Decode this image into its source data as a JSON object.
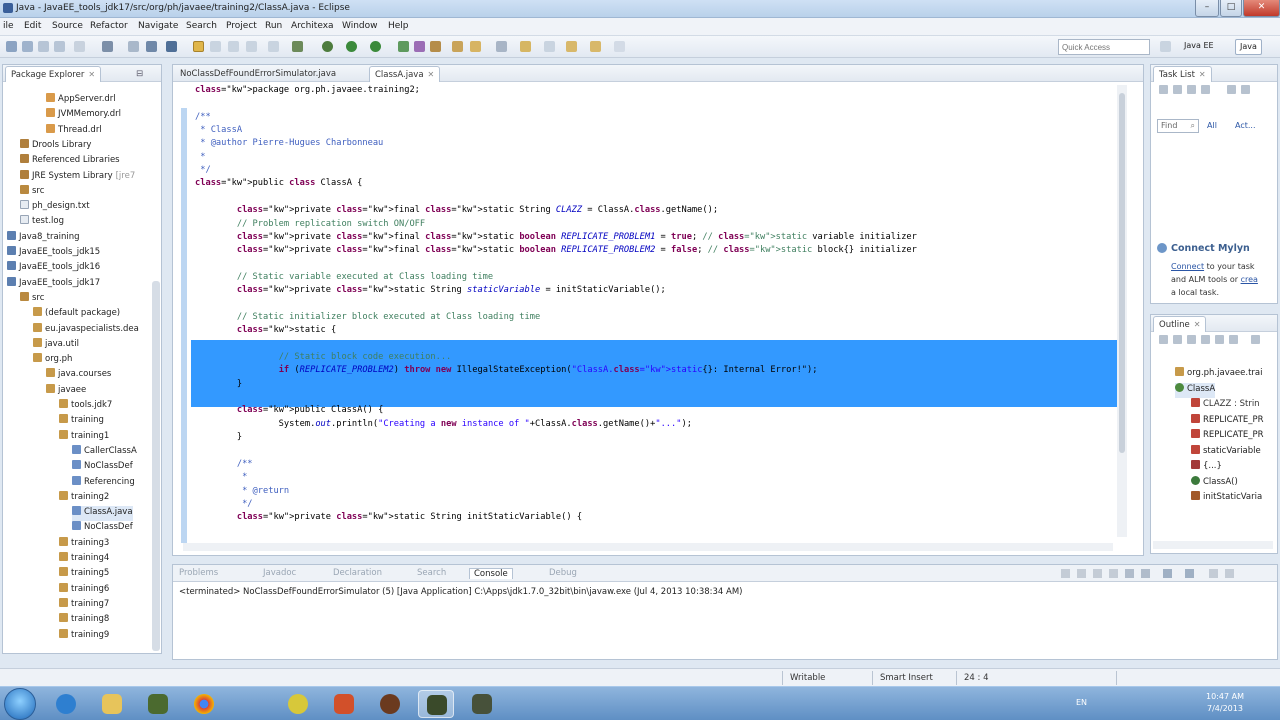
{
  "window": {
    "title": "Java - JavaEE_tools_jdk17/src/org/ph/javaee/training2/ClassA.java - Eclipse"
  },
  "menu": [
    "ile",
    "Edit",
    "Source",
    "Refactor",
    "Navigate",
    "Search",
    "Project",
    "Run",
    "Architexa",
    "Window",
    "Help"
  ],
  "toolbar": {
    "quick_access_placeholder": "Quick Access",
    "perspectives": [
      "Java EE",
      "Java"
    ]
  },
  "package_explorer": {
    "title": "Package Explorer",
    "items": [
      {
        "label": "AppServer.drl",
        "icon": "drl-file-icon",
        "indent": 4
      },
      {
        "label": "JVMMemory.drl",
        "icon": "drl-file-icon",
        "indent": 4
      },
      {
        "label": "Thread.drl",
        "icon": "drl-file-icon",
        "indent": 4
      },
      {
        "label": "Drools Library",
        "icon": "library-icon",
        "indent": 2
      },
      {
        "label": "Referenced Libraries",
        "icon": "library-icon",
        "indent": 2
      },
      {
        "label": "JRE System Library",
        "suffix": "[jre7",
        "icon": "library-icon",
        "indent": 2
      },
      {
        "label": "src",
        "icon": "source-folder-icon",
        "indent": 2
      },
      {
        "label": "ph_design.txt",
        "icon": "text-file-icon",
        "indent": 2
      },
      {
        "label": "test.log",
        "icon": "text-file-icon",
        "indent": 2
      },
      {
        "label": "Java8_training",
        "icon": "project-icon",
        "indent": 1
      },
      {
        "label": "JavaEE_tools_jdk15",
        "icon": "project-icon",
        "indent": 1
      },
      {
        "label": "JavaEE_tools_jdk16",
        "icon": "project-icon",
        "indent": 1
      },
      {
        "label": "JavaEE_tools_jdk17",
        "icon": "project-icon",
        "indent": 1
      },
      {
        "label": "src",
        "icon": "source-folder-icon",
        "indent": 2
      },
      {
        "label": "(default package)",
        "icon": "package-icon",
        "indent": 3
      },
      {
        "label": "eu.javaspecialists.dea",
        "icon": "package-icon",
        "indent": 3
      },
      {
        "label": "java.util",
        "icon": "package-icon",
        "indent": 3
      },
      {
        "label": "org.ph",
        "icon": "package-icon",
        "indent": 3
      },
      {
        "label": "java.courses",
        "icon": "package-icon",
        "indent": 4
      },
      {
        "label": "javaee",
        "icon": "package-icon",
        "indent": 4
      },
      {
        "label": "tools.jdk7",
        "icon": "package-icon",
        "indent": 5
      },
      {
        "label": "training",
        "icon": "package-icon",
        "indent": 5
      },
      {
        "label": "training1",
        "icon": "package-icon",
        "indent": 5
      },
      {
        "label": "CallerClassA",
        "icon": "java-file-icon",
        "indent": 6
      },
      {
        "label": "NoClassDef",
        "icon": "java-file-icon",
        "indent": 6
      },
      {
        "label": "Referencing",
        "icon": "java-file-icon",
        "indent": 6
      },
      {
        "label": "training2",
        "icon": "package-icon",
        "indent": 5
      },
      {
        "label": "ClassA.java",
        "icon": "java-file-icon",
        "indent": 6
      },
      {
        "label": "NoClassDef",
        "icon": "java-file-icon",
        "indent": 6
      },
      {
        "label": "training3",
        "icon": "package-icon",
        "indent": 5
      },
      {
        "label": "training4",
        "icon": "package-icon",
        "indent": 5
      },
      {
        "label": "training5",
        "icon": "package-icon",
        "indent": 5
      },
      {
        "label": "training6",
        "icon": "package-icon",
        "indent": 5
      },
      {
        "label": "training7",
        "icon": "package-icon",
        "indent": 5
      },
      {
        "label": "training8",
        "icon": "package-icon",
        "indent": 5
      },
      {
        "label": "training9",
        "icon": "package-icon",
        "indent": 5
      }
    ]
  },
  "editor": {
    "tabs": [
      {
        "label": "NoClassDefFoundErrorSimulator.java",
        "active": false
      },
      {
        "label": "ClassA.java",
        "active": true
      }
    ],
    "lines": [
      {
        "t": "package org.ph.javaee.training2;",
        "c": "plain"
      },
      {
        "t": "",
        "c": "plain"
      },
      {
        "t": "/**",
        "c": "jd"
      },
      {
        "t": " * ClassA",
        "c": "jd"
      },
      {
        "t": " * @author Pierre-Hugues Charbonneau",
        "c": "jd"
      },
      {
        "t": " *",
        "c": "jd"
      },
      {
        "t": " */",
        "c": "jd"
      },
      {
        "t": "public class ClassA {",
        "c": "kwline"
      },
      {
        "t": "",
        "c": "plain"
      },
      {
        "t": "        private final static String CLAZZ = ClassA.class.getName();",
        "c": "decl"
      },
      {
        "t": "        // Problem replication switch ON/OFF",
        "c": "cm"
      },
      {
        "t": "        private final static boolean REPLICATE_PROBLEM1 = true; // static variable initializer",
        "c": "decl"
      },
      {
        "t": "        private final static boolean REPLICATE_PROBLEM2 = false; // static block{} initializer",
        "c": "decl"
      },
      {
        "t": "",
        "c": "plain"
      },
      {
        "t": "        // Static variable executed at Class loading time",
        "c": "cm"
      },
      {
        "t": "        private static String staticVariable = initStaticVariable();",
        "c": "decl"
      },
      {
        "t": "",
        "c": "plain"
      },
      {
        "t": "        // Static initializer block executed at Class loading time",
        "c": "cm"
      },
      {
        "t": "        static {",
        "c": "sel"
      },
      {
        "t": "",
        "c": "sel"
      },
      {
        "t": "                // Static block code execution...",
        "c": "sel"
      },
      {
        "t": "                if (REPLICATE_PROBLEM2) throw new IllegalStateException(\"ClassA.static{}: Internal Error!\");",
        "c": "sel"
      },
      {
        "t": "        }",
        "c": "sel"
      },
      {
        "t": "",
        "c": "plain"
      },
      {
        "t": "        public ClassA() {",
        "c": "decl"
      },
      {
        "t": "                System.out.println(\"Creating a new instance of \"+ClassA.class.getName()+\"...\");",
        "c": "decl"
      },
      {
        "t": "        }",
        "c": "plain"
      },
      {
        "t": "",
        "c": "plain"
      },
      {
        "t": "        /**",
        "c": "jd"
      },
      {
        "t": "         *",
        "c": "jd"
      },
      {
        "t": "         * @return",
        "c": "jd"
      },
      {
        "t": "         */",
        "c": "jd"
      },
      {
        "t": "        private static String initStaticVariable() {",
        "c": "decl"
      }
    ]
  },
  "task_list": {
    "title": "Task List",
    "find_placeholder": "Find",
    "filter_all": "All",
    "filter_activate": "Act...",
    "mylyn_title": "Connect Mylyn",
    "mylyn_link": "Connect",
    "mylyn_text1": " to your task",
    "mylyn_text2a": "and ALM tools or ",
    "mylyn_link2": "crea",
    "mylyn_text3": "a local task."
  },
  "outline": {
    "title": "Outline",
    "items": [
      {
        "label": "org.ph.javaee.trai",
        "icon": "package-icon",
        "indent": 0
      },
      {
        "label": "ClassA",
        "icon": "class-icon",
        "indent": 0,
        "selected": true
      },
      {
        "label": "CLAZZ : Strin",
        "icon": "field-icon",
        "indent": 1
      },
      {
        "label": "REPLICATE_PR",
        "icon": "field-icon",
        "indent": 1
      },
      {
        "label": "REPLICATE_PR",
        "icon": "field-icon",
        "indent": 1
      },
      {
        "label": "staticVariable",
        "icon": "field-icon",
        "indent": 1
      },
      {
        "label": "{...}",
        "icon": "initializer-icon",
        "indent": 1
      },
      {
        "label": "ClassA()",
        "icon": "constructor-icon",
        "indent": 1
      },
      {
        "label": "initStaticVaria",
        "icon": "method-icon",
        "indent": 1
      }
    ]
  },
  "bottom": {
    "tabs": [
      "Problems",
      "Javadoc",
      "Declaration",
      "Search",
      "Console",
      "Debug"
    ],
    "active_tab": "Console",
    "console_text": "<terminated> NoClassDefFoundErrorSimulator (5) [Java Application] C:\\Apps\\jdk1.7.0_32bit\\bin\\javaw.exe (Jul 4, 2013 10:38:34 AM)"
  },
  "status": {
    "writable": "Writable",
    "insert_mode": "Smart Insert",
    "position": "24 : 4"
  },
  "taskbar": {
    "language": "EN",
    "time": "10:47 AM",
    "date": "7/4/2013"
  },
  "colors": {
    "selection": "#3399ff",
    "keyword": "#7f0055",
    "comment": "#3f7f5f",
    "javadoc": "#3f5fbf",
    "string": "#2a00ff",
    "field": "#0000c0"
  }
}
